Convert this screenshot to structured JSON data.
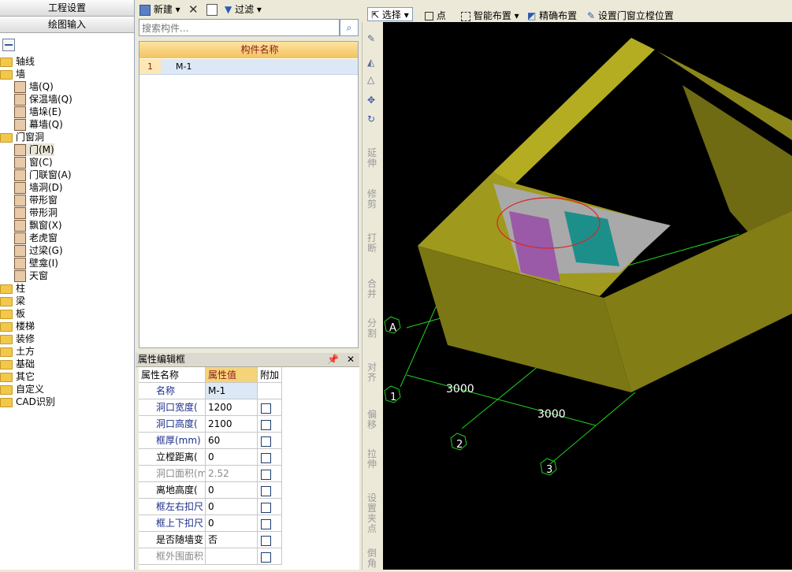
{
  "left_nav": {
    "btn1": "工程设置",
    "btn2": "绘图输入",
    "tree": [
      {
        "label": "轴线",
        "kind": "folder"
      },
      {
        "label": "墙",
        "kind": "folder"
      },
      {
        "label": "墙(Q)",
        "kind": "item"
      },
      {
        "label": "保温墙(Q)",
        "kind": "item"
      },
      {
        "label": "墙垛(E)",
        "kind": "item"
      },
      {
        "label": "幕墙(Q)",
        "kind": "item"
      },
      {
        "label": "门窗洞",
        "kind": "folder"
      },
      {
        "label": "门(M)",
        "kind": "item",
        "selected": true
      },
      {
        "label": "窗(C)",
        "kind": "item"
      },
      {
        "label": "门联窗(A)",
        "kind": "item"
      },
      {
        "label": "墙洞(D)",
        "kind": "item"
      },
      {
        "label": "带形窗",
        "kind": "item"
      },
      {
        "label": "带形洞",
        "kind": "item"
      },
      {
        "label": "飘窗(X)",
        "kind": "item"
      },
      {
        "label": "老虎窗",
        "kind": "item"
      },
      {
        "label": "过梁(G)",
        "kind": "item"
      },
      {
        "label": "壁龛(I)",
        "kind": "item"
      },
      {
        "label": "天窗",
        "kind": "item"
      },
      {
        "label": "柱",
        "kind": "folder"
      },
      {
        "label": "梁",
        "kind": "folder"
      },
      {
        "label": "板",
        "kind": "folder"
      },
      {
        "label": "楼梯",
        "kind": "folder"
      },
      {
        "label": "装修",
        "kind": "folder"
      },
      {
        "label": "土方",
        "kind": "folder"
      },
      {
        "label": "基础",
        "kind": "folder"
      },
      {
        "label": "其它",
        "kind": "folder"
      },
      {
        "label": "自定义",
        "kind": "folder"
      },
      {
        "label": "CAD识别",
        "kind": "folder"
      }
    ]
  },
  "mid_toolbar": {
    "new": "新建",
    "filter": "过滤"
  },
  "search": {
    "placeholder": "搜索构件..."
  },
  "grid": {
    "header": "构件名称",
    "row_num": "1",
    "row_name": "M-1"
  },
  "prop": {
    "title": "属性编辑框",
    "h_name": "属性名称",
    "h_value": "属性值",
    "h_extra": "附加",
    "rows": [
      {
        "name": "名称",
        "value": "M-1",
        "check": false
      },
      {
        "name": "洞口宽度(",
        "value": "1200",
        "check": true
      },
      {
        "name": "洞口高度(",
        "value": "2100",
        "check": true
      },
      {
        "name": "框厚(mm)",
        "value": "60",
        "check": true
      },
      {
        "name": "立樘距离(",
        "value": "0",
        "check": true
      },
      {
        "name": "洞口面积(m",
        "value": "2.52",
        "check": true
      },
      {
        "name": "离地高度(",
        "value": "0",
        "check": true
      },
      {
        "name": "框左右扣尺",
        "value": "0",
        "check": true
      },
      {
        "name": "框上下扣尺",
        "value": "0",
        "check": true
      },
      {
        "name": "是否随墙变",
        "value": "否",
        "check": true
      },
      {
        "name": "框外围面积",
        "value": "",
        "check": true
      }
    ]
  },
  "top_toolbar": {
    "select": "选择",
    "point": "点",
    "smart": "智能布置",
    "precise": "精确布置",
    "set_pos": "设置门窗立樘位置"
  },
  "vtools": {
    "extend": "延伸",
    "trim": "修剪",
    "break": "打断",
    "merge": "合并",
    "split": "分割",
    "align": "对齐",
    "offset": "偏移",
    "stretch": "拉伸",
    "set_grip": "设置夹点",
    "chamfer": "倒角"
  },
  "canvas": {
    "axis_a": "A",
    "axis_1": "1",
    "axis_2": "2",
    "axis_3": "3",
    "dim1": "3000",
    "dim2": "3000"
  },
  "colors": {
    "wall": "#7b7714",
    "wall_top": "#9f9a1e",
    "grid_line": "#1fd11f",
    "canvas_bg": "#000000"
  }
}
